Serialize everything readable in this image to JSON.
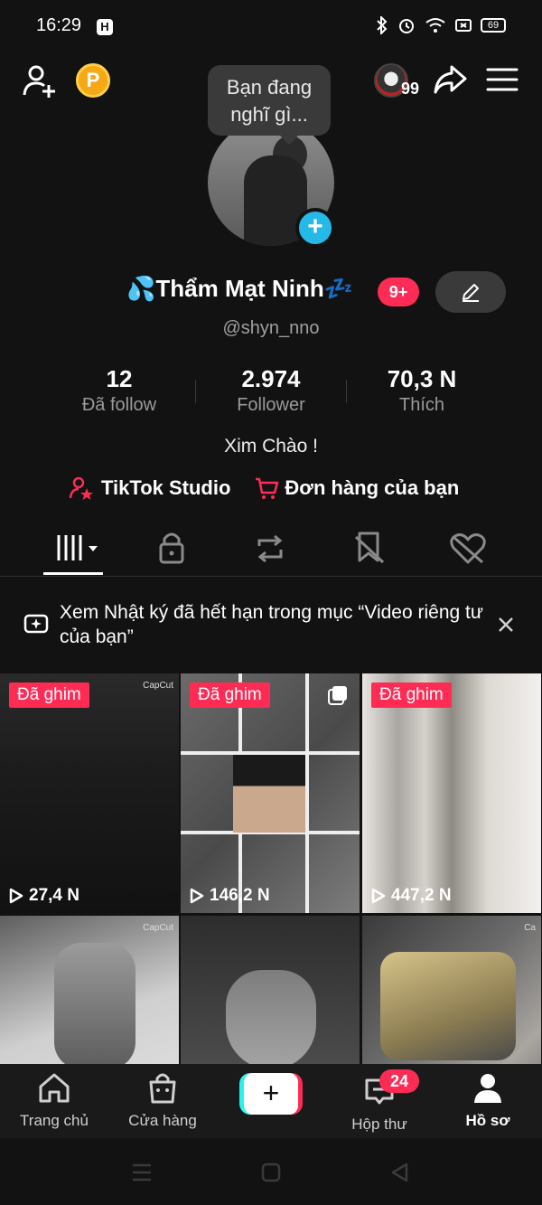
{
  "status_bar": {
    "time": "16:29",
    "app_badge": "H",
    "battery": "69",
    "icons": [
      "bluetooth-icon",
      "alarm-icon",
      "wifi-icon",
      "cast-icon",
      "battery-icon"
    ]
  },
  "header": {
    "friend_count": "99",
    "coin_letter": "P",
    "tooltip_line1": "Bạn đang",
    "tooltip_line2": "nghĩ gì..."
  },
  "profile": {
    "display_name": "💦Thẩm Mạt Ninh💤",
    "name_badge": "9+",
    "handle": "@shyn_nno",
    "bio": "Xim Chào !",
    "stats": [
      {
        "value": "12",
        "label": "Đã follow"
      },
      {
        "value": "2.974",
        "label": "Follower"
      },
      {
        "value": "70,3 N",
        "label": "Thích"
      }
    ],
    "links": {
      "studio": "TikTok Studio",
      "orders": "Đơn hàng của bạn"
    }
  },
  "tabs": [
    "grid-tab",
    "private-tab",
    "repost-tab",
    "favorites-tab",
    "liked-tab"
  ],
  "notice": {
    "text": "Xem Nhật ký đã hết hạn trong mục “Video riêng tư của bạn”"
  },
  "videos": [
    {
      "pinned": "Đã ghim",
      "views": "27,4 N",
      "watermark": "CapCut"
    },
    {
      "pinned": "Đã ghim",
      "views": "146,2 N"
    },
    {
      "pinned": "Đã ghim",
      "views": "447,2 N"
    },
    {
      "watermark": "CapCut"
    },
    {},
    {
      "watermark": "Ca"
    }
  ],
  "bottom_nav": {
    "home": "Trang chủ",
    "shop": "Cửa hàng",
    "inbox": "Hộp thư",
    "inbox_badge": "24",
    "profile": "Hồ sơ"
  },
  "colors": {
    "background": "#121212",
    "accent": "#fe2c55",
    "story_add": "#24b9e6",
    "coin": "#f7a815"
  }
}
